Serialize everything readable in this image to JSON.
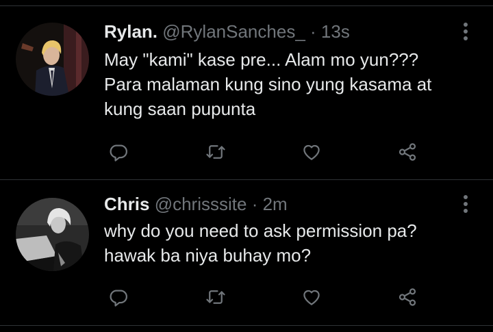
{
  "colors": {
    "background": "#000000",
    "text": "#e7e9ea",
    "secondary": "#71767b",
    "divider": "#2f3336"
  },
  "tweets": [
    {
      "name": "Rylan.",
      "handle": "@RylanSanches_",
      "separator": "·",
      "time": "13s",
      "lines": [
        "May \"kami\" kase pre... Alam mo yun???",
        "Para malaman kung sino yung kasama at",
        "kung saan pupunta"
      ],
      "avatar_icon": "avatar-photo",
      "actions": [
        "reply-icon",
        "retweet-icon",
        "like-icon",
        "share-icon"
      ]
    },
    {
      "name": "Chris",
      "handle": "@chrisssite",
      "separator": "·",
      "time": "2m",
      "lines": [
        "why do you need to ask permission pa?",
        "hawak ba niya buhay mo?"
      ],
      "avatar_icon": "avatar-photo",
      "actions": [
        "reply-icon",
        "retweet-icon",
        "like-icon",
        "share-icon"
      ]
    }
  ]
}
